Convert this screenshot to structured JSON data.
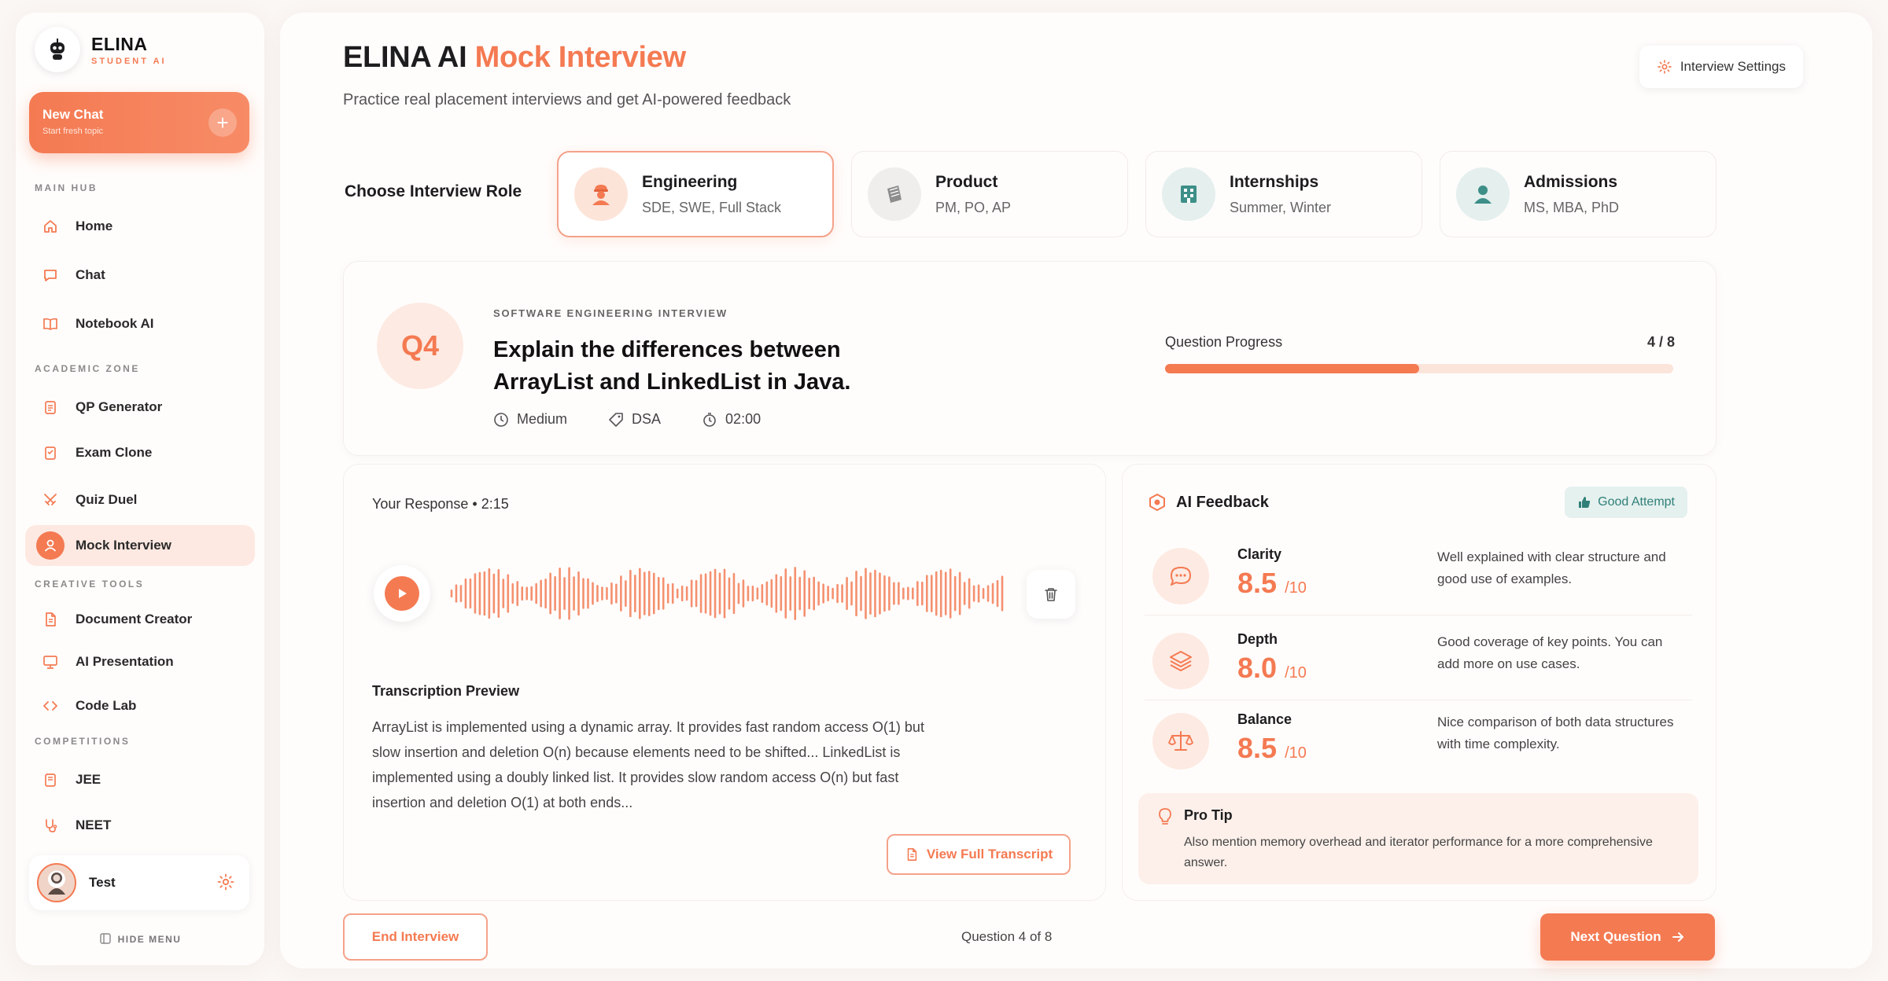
{
  "brand": {
    "name": "ELINA",
    "sub": "STUDENT AI"
  },
  "new_chat": {
    "title": "New Chat",
    "subtitle": "Start fresh topic",
    "plus": "+"
  },
  "sidebar": {
    "sections": [
      "MAIN HUB",
      "ACADEMIC ZONE",
      "CREATIVE TOOLS",
      "COMPETITIONS"
    ],
    "items": [
      {
        "label": "Home",
        "icon": "home-icon"
      },
      {
        "label": "Chat",
        "icon": "chat-icon"
      },
      {
        "label": "Notebook AI",
        "icon": "book-icon"
      },
      {
        "label": "QP Generator",
        "icon": "clipboard-icon"
      },
      {
        "label": "Exam Clone",
        "icon": "exam-icon"
      },
      {
        "label": "Quiz Duel",
        "icon": "swords-icon"
      },
      {
        "label": "Mock Interview",
        "icon": "user-icon",
        "active": true
      },
      {
        "label": "Document Creator",
        "icon": "document-icon"
      },
      {
        "label": "AI Presentation",
        "icon": "presentation-icon"
      },
      {
        "label": "Code Lab",
        "icon": "code-icon"
      },
      {
        "label": "JEE",
        "icon": "exam-book-icon"
      },
      {
        "label": "NEET",
        "icon": "stethoscope-icon"
      }
    ],
    "user_name": "Test",
    "hide_menu": "HIDE MENU"
  },
  "header": {
    "title_main": "ELINA AI ",
    "title_accent": "Mock Interview",
    "subtitle": "Practice real placement interviews and get AI-powered feedback",
    "settings_label": "Interview Settings"
  },
  "roles": {
    "label": "Choose Interview Role",
    "items": [
      {
        "name": "Engineering",
        "desc": "SDE, SWE, Full Stack",
        "selected": true
      },
      {
        "name": "Product",
        "desc": "PM, PO, AP"
      },
      {
        "name": "Internships",
        "desc": "Summer, Winter"
      },
      {
        "name": "Admissions",
        "desc": "MS, MBA, PhD"
      }
    ]
  },
  "question": {
    "badge": "Q4",
    "kicker": "SOFTWARE ENGINEERING INTERVIEW",
    "text": "Explain the differences between ArrayList and LinkedList in Java.",
    "difficulty": "Medium",
    "topic": "DSA",
    "time": "02:00",
    "progress_label": "Question Progress",
    "progress_count": "4 / 8",
    "progress_fraction": 0.5
  },
  "response": {
    "title": "Your Response • 2:15",
    "transcription_title": "Transcription Preview",
    "transcription": "ArrayList is implemented using a dynamic array. It provides fast random access O(1) but slow insertion and deletion O(n) because elements need to be shifted... LinkedList is implemented using a doubly linked list. It provides slow random access O(n) but fast insertion and deletion O(1) at both ends...",
    "view_transcript": "View Full Transcript"
  },
  "feedback": {
    "title": "AI Feedback",
    "badge": "Good Attempt",
    "metrics": [
      {
        "name": "Clarity",
        "score": "8.5",
        "out_of": "/10",
        "desc": "Well explained with clear structure and good use of examples."
      },
      {
        "name": "Depth",
        "score": "8.0",
        "out_of": "/10",
        "desc": "Good coverage of key points. You can add more on use cases."
      },
      {
        "name": "Balance",
        "score": "8.5",
        "out_of": "/10",
        "desc": "Nice comparison of both data structures with time complexity."
      }
    ],
    "tip_title": "Pro Tip",
    "tip_text": "Also mention memory overhead and iterator performance for a more comprehensive answer."
  },
  "footer": {
    "end_label": "End Interview",
    "question_of": "Question 4 of 8",
    "next_label": "Next Question"
  },
  "colors": {
    "accent": "#f47a52",
    "accent_soft": "#fdeae2",
    "good": "#2f7f78"
  }
}
